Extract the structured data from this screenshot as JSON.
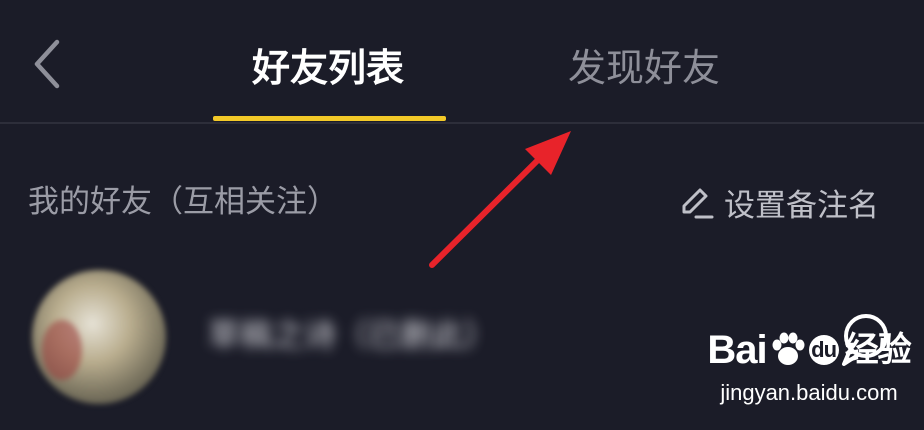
{
  "header": {
    "tabs": [
      {
        "label": "好友列表",
        "active": true
      },
      {
        "label": "发现好友",
        "active": false
      }
    ],
    "indicator_color": "#f3c928"
  },
  "section": {
    "title": "我的好友（互相关注）",
    "action_label": "设置备注名"
  },
  "friends": [
    {
      "name": "草稿之诗（已删此）"
    }
  ],
  "watermark": {
    "logo": "Bai du 经验",
    "url": "jingyan.baidu.com"
  },
  "annotation": {
    "color": "#e8232a"
  },
  "colors": {
    "background": "#1b1c28",
    "accent": "#f3c928"
  }
}
